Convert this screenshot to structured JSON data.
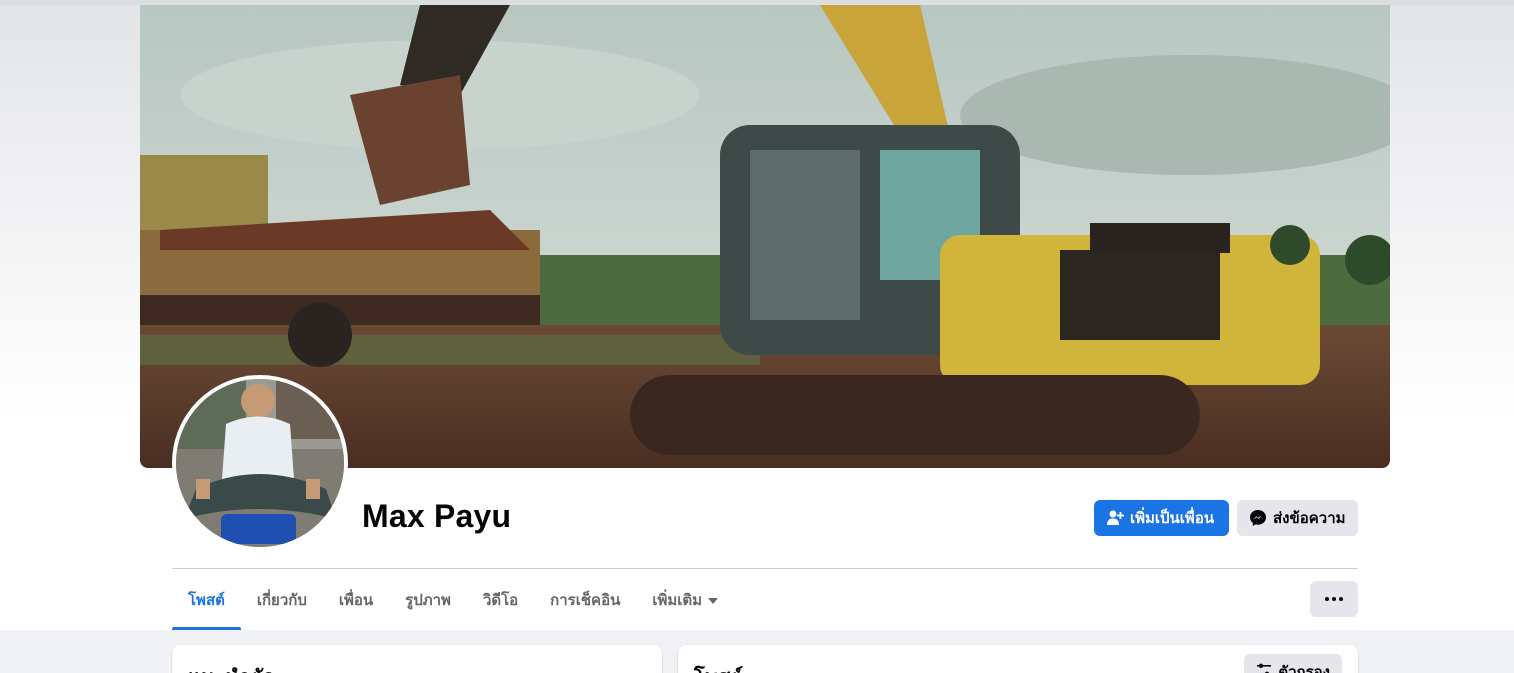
{
  "profile": {
    "name": "Max Payu"
  },
  "actions": {
    "add_friend_label": "เพิ่มเป็นเพื่อน",
    "message_label": "ส่งข้อความ"
  },
  "tabs": [
    {
      "label": "โพสต์",
      "active": true
    },
    {
      "label": "เกี่ยวกับ",
      "active": false
    },
    {
      "label": "เพื่อน",
      "active": false
    },
    {
      "label": "รูปภาพ",
      "active": false
    },
    {
      "label": "วิดีโอ",
      "active": false
    },
    {
      "label": "การเช็คอิน",
      "active": false
    },
    {
      "label": "เพิ่มเติม",
      "active": false
    }
  ],
  "cards": {
    "intro_title": "แนะนำตัว",
    "posts_title": "โพสต์",
    "filter_label": "ตัวกรอง"
  },
  "colors": {
    "accent": "#1b74e4",
    "secondary_button": "#e4e6eb",
    "page_background": "#f0f2f5"
  },
  "icons": {
    "add_friend": "person-plus-icon",
    "message": "messenger-icon",
    "more": "more-dots-icon",
    "dropdown": "caret-down-icon",
    "filter": "filter-sliders-icon"
  }
}
